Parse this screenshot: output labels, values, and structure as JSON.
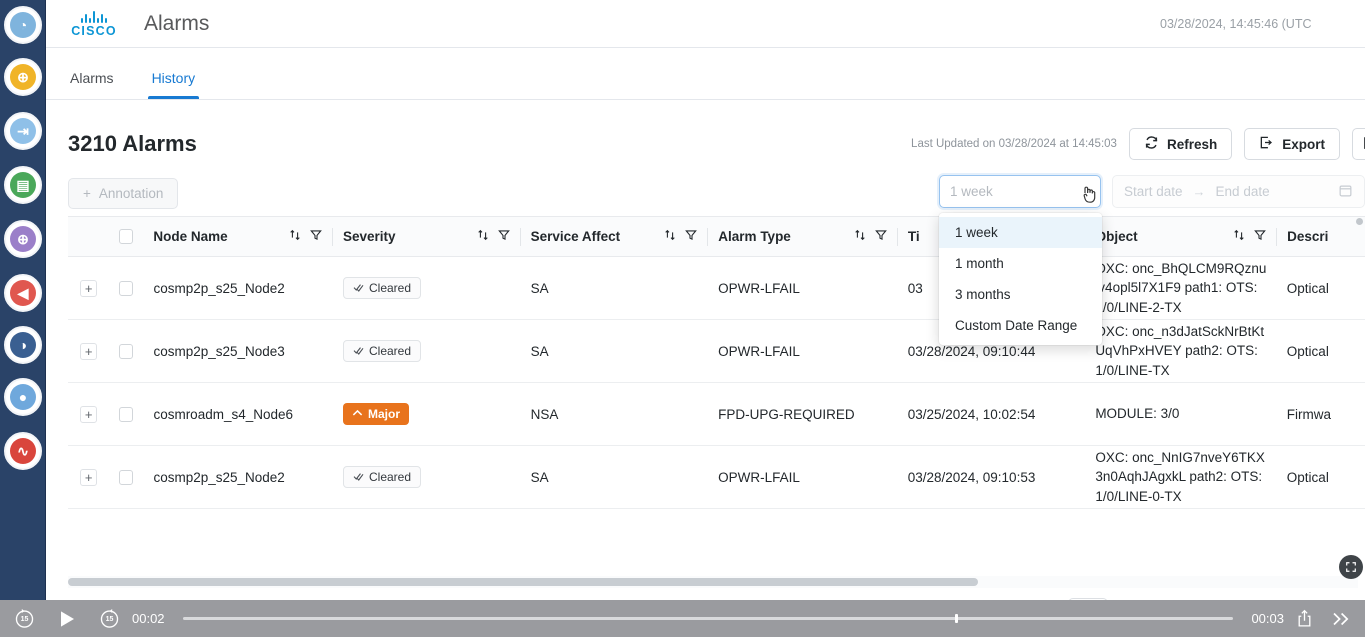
{
  "sidebar": {
    "items": [
      {
        "name": "globe-network-icon",
        "color": "#7fb4dd",
        "glyph": "◔"
      },
      {
        "name": "add-devices-icon",
        "color": "#f0b428",
        "glyph": "⊕"
      },
      {
        "name": "onboard-device-icon",
        "color": "#8fc0e8",
        "glyph": "⇥"
      },
      {
        "name": "inventory-report-icon",
        "color": "#4aa85a",
        "glyph": "▤"
      },
      {
        "name": "provision-service-icon",
        "color": "#9b7fc9",
        "glyph": "⊕"
      },
      {
        "name": "alarms-bell-icon",
        "color": "#e0574f",
        "glyph": "◀"
      },
      {
        "name": "performance-chart-icon",
        "color": "#3a5f91",
        "glyph": "◑"
      },
      {
        "name": "topology-links-icon",
        "color": "#6fa8dc",
        "glyph": "●"
      },
      {
        "name": "health-monitor-icon",
        "color": "#d9453c",
        "glyph": "∿"
      }
    ],
    "crown_icon": "crown-icon"
  },
  "header": {
    "brand": "CISCO",
    "brand_icon": "cisco-bridge-logo",
    "title": "Alarms",
    "clock": "03/28/2024, 14:45:46 (UTC"
  },
  "tabs": [
    {
      "label": "Alarms",
      "active": false
    },
    {
      "label": "History",
      "active": true
    }
  ],
  "toolbar": {
    "page_title": "3210 Alarms",
    "last_updated": "Last Updated on 03/28/2024 at 14:45:03",
    "refresh_label": "Refresh",
    "refresh_icon": "refresh-icon",
    "export_label": "Export",
    "export_icon": "export-icon",
    "extra_icon": "open-external-icon"
  },
  "filters": {
    "annotation_label": "Annotation",
    "annotation_icon": "plus-icon",
    "range_select_value": "1 week",
    "range_chevron_icon": "chevron-down-icon",
    "cursor_icon": "pointer-hand-cursor",
    "start_date_placeholder": "Start date",
    "end_date_placeholder": "End date",
    "range_arrow": "→",
    "calendar_icon": "calendar-icon"
  },
  "dropdown": {
    "options": [
      {
        "label": "1 week",
        "selected": true
      },
      {
        "label": "1 month",
        "selected": false
      },
      {
        "label": "3 months",
        "selected": false
      },
      {
        "label": "Custom Date Range",
        "selected": false
      }
    ]
  },
  "table": {
    "select_all_icon": "checkbox-unchecked",
    "sort_icon": "sort-icon",
    "filter_icon": "funnel-filter-icon",
    "expand_icon": "plus-expand-icon",
    "columns": [
      "Node Name",
      "Severity",
      "Service Affect",
      "Alarm Type",
      "Ti",
      "Object",
      "Descri"
    ],
    "rows": [
      {
        "node": "cosmp2p_s25_Node2",
        "severity": "Cleared",
        "severity_kind": "cleared",
        "severity_icon": "check-double-icon",
        "service_affect": "SA",
        "alarm_type": "OPWR-LFAIL",
        "time": "03",
        "object": "OXC: onc_BhQLCM9RQznuiv4opl5l7X1F9 path1: OTS:1/0/LINE-2-TX",
        "description": "Optical"
      },
      {
        "node": "cosmp2p_s25_Node3",
        "severity": "Cleared",
        "severity_kind": "cleared",
        "severity_icon": "check-double-icon",
        "service_affect": "SA",
        "alarm_type": "OPWR-LFAIL",
        "time": "03/28/2024, 09:10:44",
        "object": "OXC: onc_n3dJatSckNrBtKtUqVhPxHVEY path2: OTS:1/0/LINE-TX",
        "description": "Optical"
      },
      {
        "node": "cosmroadm_s4_Node6",
        "severity": "Major",
        "severity_kind": "major",
        "severity_icon": "chevron-up-icon",
        "service_affect": "NSA",
        "alarm_type": "FPD-UPG-REQUIRED",
        "time": "03/25/2024, 10:02:54",
        "object": "MODULE: 3/0",
        "description": "Firmwa"
      },
      {
        "node": "cosmp2p_s25_Node2",
        "severity": "Cleared",
        "severity_kind": "cleared",
        "severity_icon": "check-double-icon",
        "service_affect": "SA",
        "alarm_type": "OPWR-LFAIL",
        "time": "03/28/2024, 09:10:53",
        "object": "OXC: onc_NnIG7nveY6TKX3n0AqhJAgxkL path2: OTS:1/0/LINE-0-TX",
        "description": "Optical"
      }
    ],
    "fab_icon": "expand-fullscreen-icon"
  },
  "player": {
    "rewind_icon": "rewind-15-icon",
    "rewind_label": "15",
    "play_icon": "play-icon",
    "forward_icon": "forward-15-icon",
    "forward_label": "15",
    "current_time": "00:02",
    "total_time": "00:03",
    "share_icon": "share-upload-icon",
    "next_icon": "fast-forward-icon"
  },
  "colors": {
    "sidebar_bg": "#2a4368",
    "accent_blue": "#187ad2",
    "major_orange": "#e8731c",
    "player_bg": "#9a9b9f"
  }
}
